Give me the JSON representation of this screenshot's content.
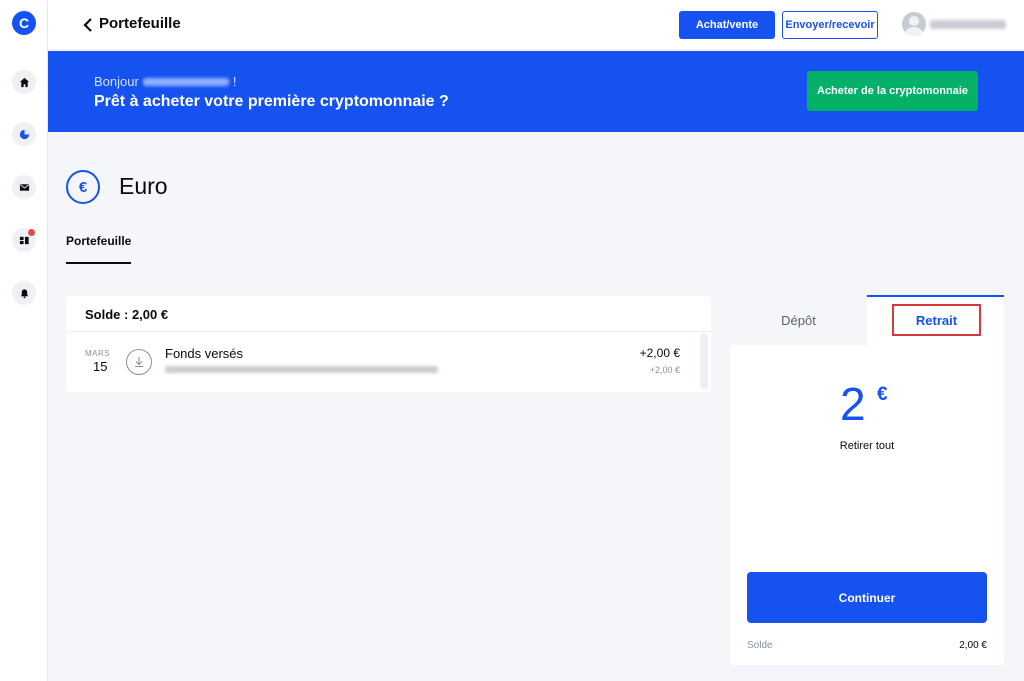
{
  "app": {
    "logo_letter": "C",
    "brand_color": "#1652f0"
  },
  "sidebar": {
    "items": [
      {
        "icon": "home-icon"
      },
      {
        "icon": "portfolio-pie-icon"
      },
      {
        "icon": "inbox-icon"
      },
      {
        "icon": "dashboard-icon",
        "notification": true
      },
      {
        "icon": "bell-icon"
      }
    ]
  },
  "header": {
    "title": "Portefeuille",
    "buy_sell_label": "Achat/vente",
    "send_receive_label": "Envoyer/recevoir"
  },
  "banner": {
    "greeting": "Bonjour",
    "greeting_suffix": "!",
    "title": "Prêt à acheter votre première cryptomonnaie ?",
    "cta_label": "Acheter de la cryptomonnaie",
    "background_color": "#1652f0",
    "cta_color": "#05b169"
  },
  "asset": {
    "symbol": "€",
    "name": "Euro",
    "tab_label": "Portefeuille"
  },
  "transactions": {
    "balance_title": "Solde : 2,00 €",
    "items": [
      {
        "month": "MARS",
        "day": "15",
        "title": "Fonds versés",
        "amount": "+2,00 €",
        "amount_sub": "+2,00 €"
      }
    ]
  },
  "panel": {
    "tab_deposit": "Dépôt",
    "tab_withdraw": "Retrait",
    "amount": "2",
    "currency": "€",
    "withdraw_all_label": "Retirer tout",
    "continue_label": "Continuer",
    "balance_label": "Solde",
    "balance_value": "2,00 €"
  }
}
